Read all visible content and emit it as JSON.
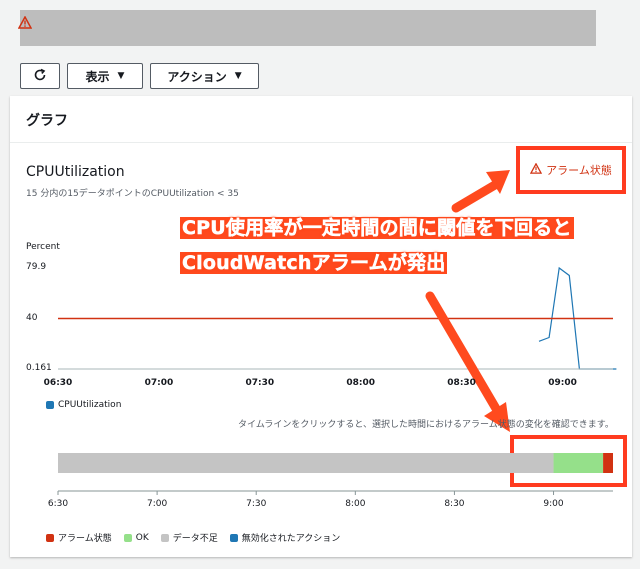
{
  "toolbar": {
    "view_label": "表示",
    "actions_label": "アクション"
  },
  "panel": {
    "title": "グラフ"
  },
  "chart": {
    "title": "CPUUtilization",
    "subtitle": "15 分内の15データポイントのCPUUtilization < 35",
    "alarm_badge": "アラーム状態"
  },
  "annotation": {
    "line1": "CPU使用率が一定時間の間に閾値を下回ると",
    "line2": "CloudWatchアラームが発出"
  },
  "timeline": {
    "hint": "タイムラインをクリックすると、選択した時間におけるアラーム状態の変化を確認できます。",
    "x_labels": [
      "6:30",
      "7:00",
      "7:30",
      "8:00",
      "8:30",
      "9:00"
    ],
    "legend": [
      {
        "label": "アラーム状態",
        "color": "#d13212"
      },
      {
        "label": "OK",
        "color": "#95e08a"
      },
      {
        "label": "データ不足",
        "color": "#c4c4c4"
      },
      {
        "label": "無効化されたアクション",
        "color": "#1f77b4"
      }
    ],
    "segments": [
      {
        "state": "データ不足",
        "start": "06:30",
        "end": "09:00"
      },
      {
        "state": "OK",
        "start": "09:00",
        "end": "09:15"
      },
      {
        "state": "アラーム状態",
        "start": "09:15",
        "end": "09:18"
      }
    ]
  },
  "colors": {
    "accent_red": "#d13212",
    "threshold": "#d13212",
    "series": "#1f77b4",
    "annotation": "#ff4a1e"
  },
  "chart_data": {
    "type": "line",
    "title": "CPUUtilization",
    "ylabel": "Percent",
    "yticks": [
      "79.9",
      "40",
      "0.161"
    ],
    "ylim": [
      0.161,
      79.9
    ],
    "x_labels": [
      "06:30",
      "07:00",
      "07:30",
      "08:00",
      "08:30",
      "09:00"
    ],
    "threshold": 40,
    "series": [
      {
        "name": "CPUUtilization",
        "color": "#1f77b4",
        "points": [
          [
            "08:53",
            22
          ],
          [
            "08:56",
            25
          ],
          [
            "08:59",
            79.9
          ],
          [
            "09:02",
            74
          ],
          [
            "09:05",
            0.161
          ],
          [
            "09:16",
            0.161
          ]
        ]
      }
    ]
  }
}
